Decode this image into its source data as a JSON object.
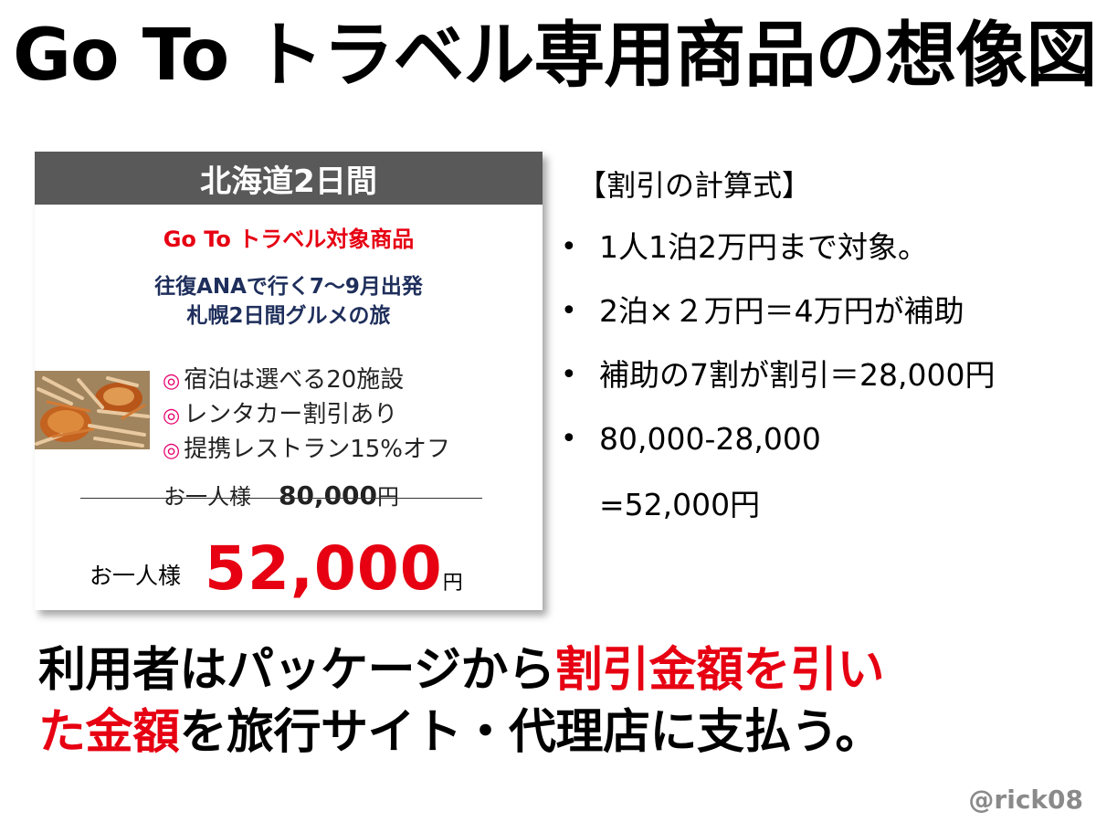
{
  "title": "Go To トラベル専用商品の想像図",
  "card": {
    "header": "北海道2日間",
    "product_tag": "Go To トラベル対象商品",
    "tour_name_line1": "往復ANAで行く7〜9月出発",
    "tour_name_line2": "札幌2日間グルメの旅",
    "photo_icon": "crab-photo-icon",
    "feature_bullet": "◎",
    "features": [
      "宿泊は選べる20施設",
      "レンタカー割引あり",
      "提携レストラン15%オフ"
    ],
    "old_price": {
      "label": "お一人様",
      "amount": "80,000",
      "unit": "円"
    },
    "new_price": {
      "label": "お一人様",
      "amount": "52,000",
      "unit": "円"
    }
  },
  "formula": {
    "heading": "【割引の計算式】",
    "items": [
      "1人1泊2万円まで対象。",
      "2泊×２万円＝4万円が補助",
      "補助の7割が割引＝28,000円",
      "80,000-28,000"
    ],
    "continuation": "=52,000円"
  },
  "summary": {
    "part1": "利用者はパッケージから",
    "highlight1": "割引金額を引い",
    "highlight2": "た金額",
    "part2": "を旅行サイト・代理店に支払う。"
  },
  "credit": "@rick08",
  "colors": {
    "accent_red": "#e60012",
    "header_gray": "#595959",
    "navy": "#1f2f5c",
    "bullet_pink": "#e6006e"
  }
}
